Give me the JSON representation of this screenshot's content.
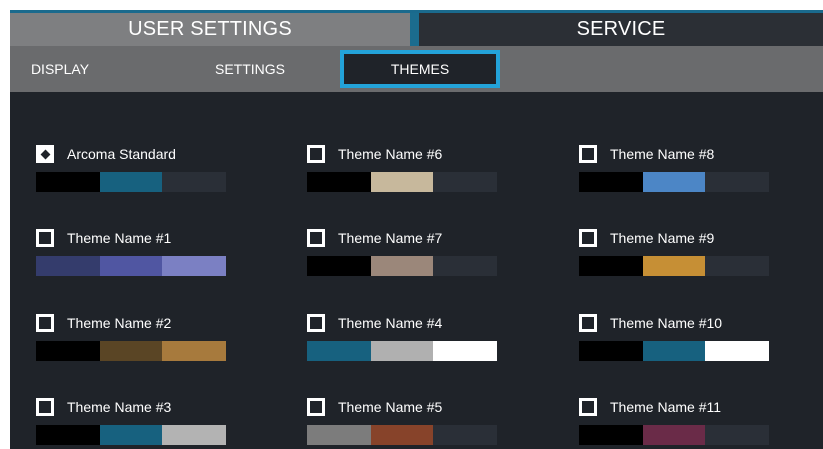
{
  "main_tabs": {
    "user_settings": "USER SETTINGS",
    "service": "SERVICE"
  },
  "sub_tabs": {
    "display": "DISPLAY",
    "settings": "SETTINGS",
    "themes": "THEMES"
  },
  "selected_theme": "Arcoma Standard",
  "themes": [
    {
      "name": "Arcoma Standard",
      "selected": true,
      "colors": [
        "#000000",
        "#17617f",
        "#2a2f37"
      ]
    },
    {
      "name": "Theme Name #1",
      "selected": false,
      "colors": [
        "#343c6c",
        "#5056a2",
        "#7b80c3"
      ]
    },
    {
      "name": "Theme Name #2",
      "selected": false,
      "colors": [
        "#000000",
        "#5a4525",
        "#a77a3d"
      ]
    },
    {
      "name": "Theme Name #3",
      "selected": false,
      "colors": [
        "#000000",
        "#17617f",
        "#b3b3b3"
      ]
    },
    {
      "name": "Theme Name #6",
      "selected": false,
      "colors": [
        "#000000",
        "#c7b89c",
        "#2a2f37"
      ]
    },
    {
      "name": "Theme Name #7",
      "selected": false,
      "colors": [
        "#000000",
        "#9b877a",
        "#2a2f37"
      ]
    },
    {
      "name": "Theme Name #4",
      "selected": false,
      "colors": [
        "#17617f",
        "#b0b0b0",
        "#ffffff"
      ]
    },
    {
      "name": "Theme Name #5",
      "selected": false,
      "colors": [
        "#7c7c7c",
        "#87432a",
        "#2a2f37"
      ]
    },
    {
      "name": "Theme Name #8",
      "selected": false,
      "colors": [
        "#000000",
        "#4c86c6",
        "#2a2f37"
      ]
    },
    {
      "name": "Theme Name #9",
      "selected": false,
      "colors": [
        "#000000",
        "#c68f35",
        "#2a2f37"
      ]
    },
    {
      "name": "Theme Name #10",
      "selected": false,
      "colors": [
        "#000000",
        "#17617f",
        "#ffffff"
      ]
    },
    {
      "name": "Theme Name #11",
      "selected": false,
      "colors": [
        "#000000",
        "#6a2b48",
        "#2a2f37"
      ]
    }
  ]
}
